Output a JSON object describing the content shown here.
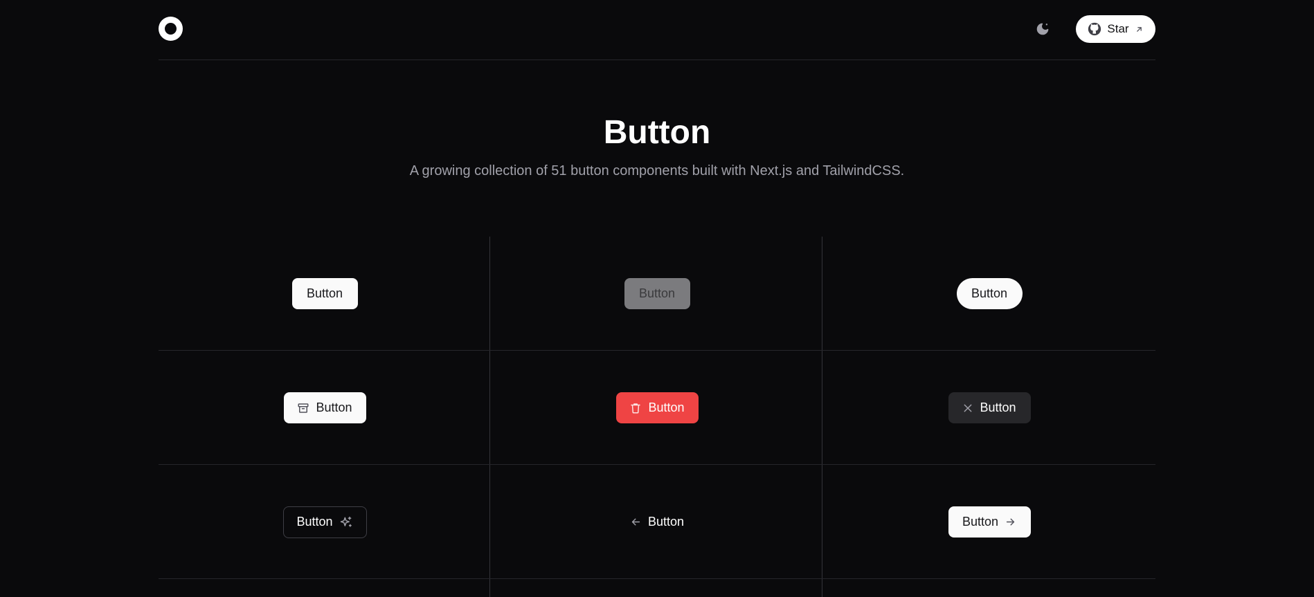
{
  "header": {
    "logo_icon": "circle-logo-icon",
    "theme_toggle_icon": "moon-icon",
    "star_button": {
      "label": "Star",
      "icon": "github-icon",
      "trailing_icon": "arrow-up-right-icon"
    }
  },
  "hero": {
    "title": "Button",
    "subtitle": "A growing collection of 51 button components built with Next.js and TailwindCSS."
  },
  "buttons": [
    {
      "label": "Button",
      "variant": "primary"
    },
    {
      "label": "Button",
      "variant": "disabled"
    },
    {
      "label": "Button",
      "variant": "pill"
    },
    {
      "label": "Button",
      "variant": "icon-left",
      "icon": "archive-icon"
    },
    {
      "label": "Button",
      "variant": "danger",
      "icon": "trash-icon"
    },
    {
      "label": "Button",
      "variant": "dark",
      "icon": "close-icon"
    },
    {
      "label": "Button",
      "variant": "outline",
      "icon": "sparkles-icon"
    },
    {
      "label": "Button",
      "variant": "ghost",
      "icon": "arrow-left-icon"
    },
    {
      "label": "Button",
      "variant": "arrow-right",
      "icon": "arrow-right-icon"
    }
  ],
  "colors": {
    "background": "#0a0a0c",
    "primary": "#fafafa",
    "danger": "#ef4444",
    "dark": "#27272a",
    "muted_text": "#a1a1aa"
  }
}
